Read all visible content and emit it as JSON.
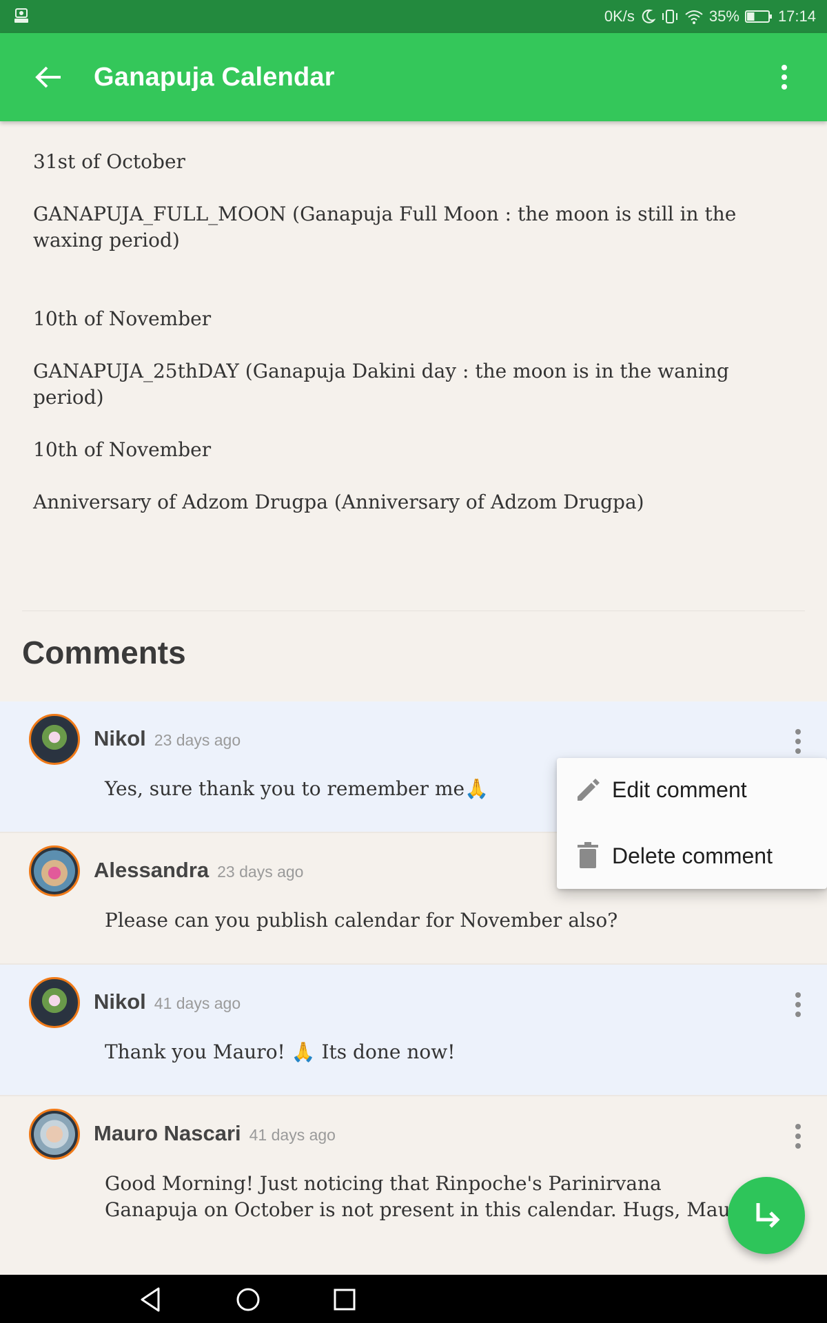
{
  "status_bar": {
    "speed": "0K/s",
    "battery_percent": "35%",
    "battery_level": 0.35,
    "time": "17:14"
  },
  "app_bar": {
    "title": "Ganapuja Calendar"
  },
  "events": [
    {
      "date": "31st of October",
      "description": "GANAPUJA_FULL_MOON (Ganapuja Full Moon : the moon is still in the waxing period)"
    },
    {
      "date": "10th of November",
      "description": "GANAPUJA_25thDAY (Ganapuja Dakini day : the moon is in the waning period)"
    },
    {
      "date": "10th of November",
      "description": "Anniversary of Adzom Drugpa (Anniversary of Adzom Drugpa)"
    }
  ],
  "comments_section": {
    "title": "Comments",
    "items": [
      {
        "author": "Nikol",
        "time": "23 days ago",
        "text": "Yes, sure thank you to remember me🙏"
      },
      {
        "author": "Alessandra",
        "time": "23 days ago",
        "text": "Please can you publish calendar for November also?"
      },
      {
        "author": "Nikol",
        "time": "41 days ago",
        "text": "Thank you Mauro! 🙏 Its done now!"
      },
      {
        "author": "Mauro Nascari",
        "time": "41 days ago",
        "text": "Good Morning! Just noticing that Rinpoche's Parinirvana Ganapuja on October is not present in this calendar. Hugs, Mauro"
      }
    ]
  },
  "popup_menu": {
    "items": [
      {
        "label": "Edit comment",
        "icon": "pencil-icon"
      },
      {
        "label": "Delete comment",
        "icon": "trash-icon"
      }
    ]
  },
  "colors": {
    "status_bar": "#238a3e",
    "app_bar": "#34c75a",
    "fab": "#2ec55a",
    "avatar_ring": "#f07a18",
    "alt_comment_bg": "#edf2fb",
    "page_bg": "#f5f1ec"
  }
}
